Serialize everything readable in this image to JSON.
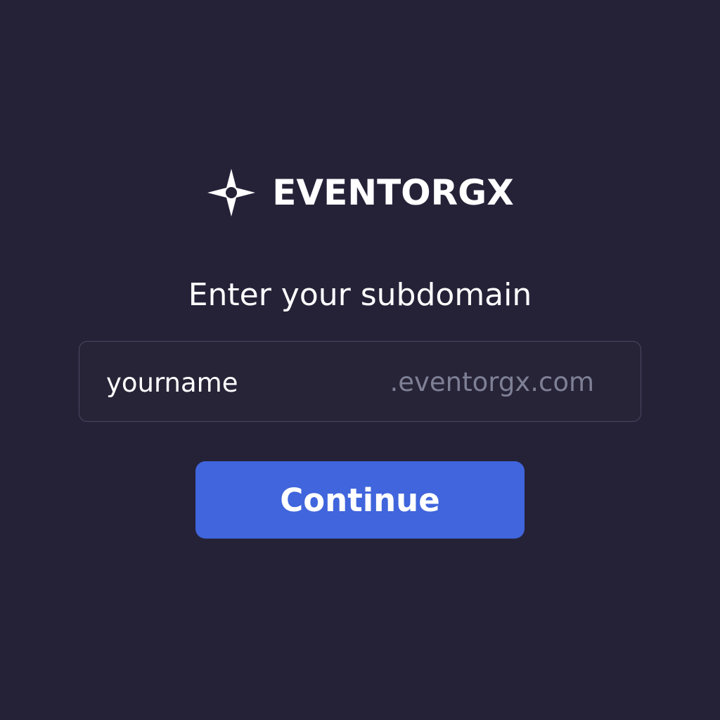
{
  "brand": {
    "name": "EVENTORGX",
    "icon": "compass-star-icon"
  },
  "form": {
    "heading": "Enter your subdomain",
    "subdomain_value": "yourname",
    "domain_suffix": ".eventorgx.com",
    "continue_label": "Continue"
  },
  "colors": {
    "background": "#252238",
    "field_border": "#4a4763",
    "suffix_text": "#7e8096",
    "accent": "#4065dc",
    "text": "#ffffff"
  }
}
